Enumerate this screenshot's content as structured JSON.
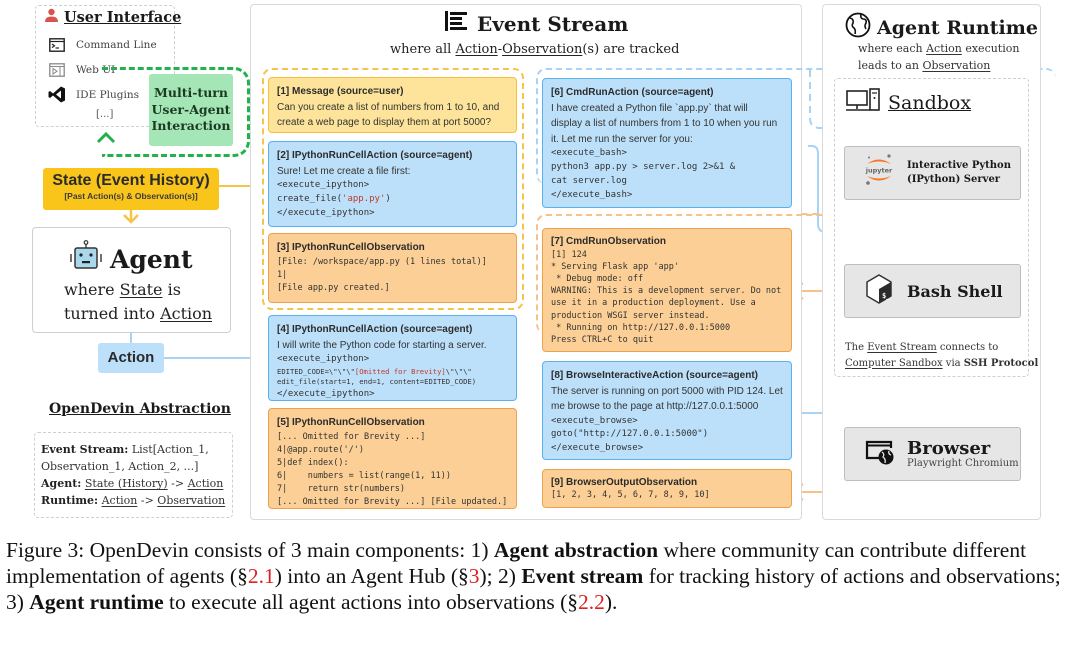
{
  "user_interface": {
    "title": "User Interface",
    "items": [
      {
        "icon": "terminal-icon",
        "label": "Command Line"
      },
      {
        "icon": "web-ui-icon",
        "label": "Web UI"
      },
      {
        "icon": "vscode-icon",
        "label": "IDE Plugins"
      }
    ],
    "more": "[...]"
  },
  "multi_turn": {
    "line1": "Multi-turn",
    "line2": "User-Agent",
    "line3": "Interaction"
  },
  "state": {
    "title": "State (Event History)",
    "subtitle": "[Past Action(s) & Observation(s)]"
  },
  "agent": {
    "title": "Agent",
    "line1_pre": "where ",
    "line1_link": "State",
    "line1_post": " is",
    "line2_pre": "turned into ",
    "line2_link": "Action"
  },
  "action_label": "Action",
  "abstraction": {
    "title": "OpenDevin Abstraction",
    "rows": [
      {
        "key": "Event Stream:",
        "value": "List[Action_1, Observation_1, Action_2, ...]"
      },
      {
        "key": "Agent:",
        "link1": "State (History)",
        "arrow": " -> ",
        "link2": "Action"
      },
      {
        "key": "Runtime:",
        "link1": "Action",
        "arrow": " -> ",
        "link2": "Observation"
      }
    ]
  },
  "event_stream": {
    "title": "Event Stream",
    "sub_pre": "where all ",
    "sub_link1": "Action",
    "sub_dash": "-",
    "sub_link2": "Observation",
    "sub_post": "(s) are tracked",
    "events": [
      {
        "id": 1,
        "kind": "message",
        "header": "[1] Message (source=user)",
        "text": [
          "Can you create a list of numbers from 1 to 10, and",
          "create a web page to display them at port 5000?"
        ],
        "code": []
      },
      {
        "id": 2,
        "kind": "action",
        "header": "[2] IPythonRunCellAction (source=agent)",
        "text": [
          "Sure! Let me create a file first:"
        ],
        "code": [
          "<execute_ipython>",
          "create_file(",
          "'app.py'",
          ")",
          "</execute_ipython>"
        ]
      },
      {
        "id": 3,
        "kind": "observation",
        "header": "[3] IPythonRunCellObservation",
        "text": [],
        "code": [
          "[File: /workspace/app.py (1 lines total)]",
          "1|",
          "[File app.py created.]"
        ]
      },
      {
        "id": 4,
        "kind": "action",
        "header": "[4] IPythonRunCellAction (source=agent)",
        "text": [
          "I will write the Python code for starting a server."
        ],
        "code": [
          "<execute_ipython>",
          "EDITED_CODE=\\\"\\\"\\\"",
          "[Omitted for Brevity]",
          "\\\"\\\"\\\"",
          "edit_file(start=1, end=1, content=EDITED_CODE)",
          "</execute_ipython>"
        ]
      },
      {
        "id": 5,
        "kind": "observation",
        "header": "[5] IPythonRunCellObservation",
        "text": [],
        "code": [
          "[... Omitted for Brevity ...]",
          "4|@app.route('/')",
          "5|def index():",
          "6|    numbers = list(range(1, 11))",
          "7|    return str(numbers)",
          "[... Omitted for Brevity ...] [File updated.]"
        ]
      },
      {
        "id": 6,
        "kind": "action",
        "header": "[6] CmdRunAction (source=agent)",
        "text": [
          "I have created a Python file `app.py` that will",
          "display a list of numbers from 1 to 10 when you run",
          "it. Let me run the server for you:"
        ],
        "code": [
          "<execute_bash>",
          "python3 app.py > server.log 2>&1 &",
          "cat server.log",
          "</execute_bash>"
        ]
      },
      {
        "id": 7,
        "kind": "observation",
        "header": "[7] CmdRunObservation",
        "text": [],
        "code": [
          "[1] 124",
          "* Serving Flask app 'app'",
          " * Debug mode: off",
          "WARNING: This is a development server. Do not",
          "use it in a production deployment. Use a",
          "production WSGI server instead.",
          " * Running on http://127.0.0.1:5000",
          "Press CTRL+C to quit"
        ]
      },
      {
        "id": 8,
        "kind": "action",
        "header": "[8] BrowseInteractiveAction (source=agent)",
        "text": [
          "The server is running on port 5000 with PID 124. Let",
          "me browse to the page at http://127.0.0.1:5000"
        ],
        "code": [
          "<execute_browse>",
          "goto(\"http://127.0.0.1:5000\")",
          "</execute_browse>"
        ]
      },
      {
        "id": 9,
        "kind": "observation",
        "header": "[9] BrowserOutputObservation",
        "text": [],
        "code": [
          "[1, 2, 3, 4, 5, 6, 7, 8, 9, 10]"
        ]
      }
    ]
  },
  "runtime": {
    "title": "Agent Runtime",
    "sub_line1_pre": "where each ",
    "sub_line1_link": "Action",
    "sub_line1_post": " execution",
    "sub_line2_pre": "leads to an ",
    "sub_line2_link": "Observation",
    "sandbox_title": "Sandbox",
    "ipython": {
      "logo": "jupyter",
      "line1": "Interactive Python",
      "line2": "(IPython) Server"
    },
    "bash": {
      "name": "Bash Shell"
    },
    "browser": {
      "name": "Browser",
      "sub": "Playwright Chromium"
    },
    "ssh_note": {
      "pre": "The ",
      "link1": "Event Stream",
      "mid": " connects to",
      "link2": "Computer Sandbox",
      "via": " via ",
      "bold": "SSH Protocol"
    }
  },
  "caption": {
    "segments": [
      {
        "t": "Figure 3: OpenDevin consists of 3 main components: 1) "
      },
      {
        "t": "Agent abstraction",
        "b": true
      },
      {
        "t": " where community can contribute different implementation of agents ("
      },
      {
        "t": "§"
      },
      {
        "t": "2.1",
        "ref": true
      },
      {
        "t": ") into an Agent Hub (§"
      },
      {
        "t": "3",
        "ref": true
      },
      {
        "t": "); 2) "
      },
      {
        "t": "Event stream",
        "b": true
      },
      {
        "t": " for tracking history of actions and observations; 3) "
      },
      {
        "t": "Agent runtime",
        "b": true
      },
      {
        "t": " to execute all agent actions into observations (§"
      },
      {
        "t": "2.2",
        "ref": true
      },
      {
        "t": ")."
      }
    ]
  },
  "colors": {
    "message_bg": "#fde49a",
    "action_bg": "#bde0fa",
    "observation_bg": "#fbcf95",
    "state_yellow": "#f9c51b",
    "multi_turn_green": "#22b14c",
    "ref_red": "#e02020"
  }
}
